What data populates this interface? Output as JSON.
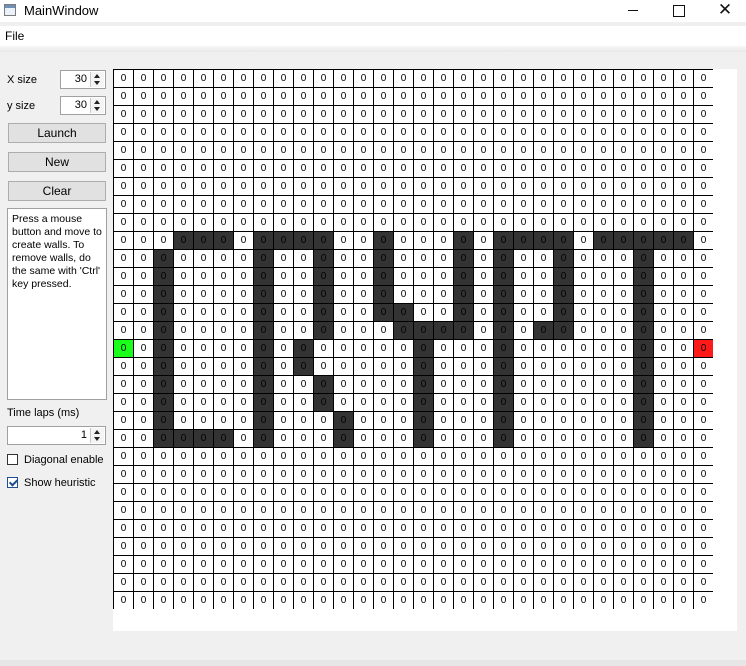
{
  "window": {
    "title": "MainWindow"
  },
  "menu": {
    "file": "File"
  },
  "controls": {
    "x_size_label": "X size",
    "x_size_value": "30",
    "y_size_label": "y size",
    "y_size_value": "30",
    "launch": "Launch",
    "new": "New",
    "clear": "Clear",
    "help_text": "Press a mouse button and move to create walls. To remove walls, do the same with 'Ctrl' key pressed.",
    "time_laps_label": "Time laps (ms)",
    "time_laps_value": "1",
    "diagonal_label": "Diagonal enable",
    "diagonal_checked": false,
    "heuristic_label": "Show heuristic",
    "heuristic_checked": true
  },
  "icons": {
    "app": "window-app-icon",
    "minimize": "minimize-icon",
    "maximize": "maximize-icon",
    "close": "close-icon",
    "start": "start-marker-icon",
    "goal": "goal-marker-icon"
  },
  "colors": {
    "wall": "#333333",
    "start": "#1aff1a",
    "goal": "#ff1a1a",
    "grid_line": "#000000",
    "cell": "#ffffff"
  },
  "grid": {
    "cols": 30,
    "rows": 30,
    "cell_value": "0",
    "start": [
      0,
      15
    ],
    "goal": [
      29,
      15
    ],
    "walls": [
      [
        3,
        9
      ],
      [
        4,
        9
      ],
      [
        5,
        9
      ],
      [
        7,
        9
      ],
      [
        8,
        9
      ],
      [
        9,
        9
      ],
      [
        10,
        9
      ],
      [
        13,
        9
      ],
      [
        17,
        9
      ],
      [
        19,
        9
      ],
      [
        20,
        9
      ],
      [
        21,
        9
      ],
      [
        22,
        9
      ],
      [
        24,
        9
      ],
      [
        25,
        9
      ],
      [
        26,
        9
      ],
      [
        27,
        9
      ],
      [
        28,
        9
      ],
      [
        2,
        10
      ],
      [
        7,
        10
      ],
      [
        10,
        10
      ],
      [
        13,
        10
      ],
      [
        17,
        10
      ],
      [
        19,
        10
      ],
      [
        22,
        10
      ],
      [
        26,
        10
      ],
      [
        2,
        11
      ],
      [
        7,
        11
      ],
      [
        10,
        11
      ],
      [
        13,
        11
      ],
      [
        17,
        11
      ],
      [
        19,
        11
      ],
      [
        22,
        11
      ],
      [
        26,
        11
      ],
      [
        2,
        12
      ],
      [
        7,
        12
      ],
      [
        10,
        12
      ],
      [
        13,
        12
      ],
      [
        17,
        12
      ],
      [
        19,
        12
      ],
      [
        22,
        12
      ],
      [
        26,
        12
      ],
      [
        2,
        13
      ],
      [
        7,
        13
      ],
      [
        10,
        13
      ],
      [
        13,
        13
      ],
      [
        14,
        13
      ],
      [
        17,
        13
      ],
      [
        19,
        13
      ],
      [
        22,
        13
      ],
      [
        26,
        13
      ],
      [
        2,
        14
      ],
      [
        7,
        14
      ],
      [
        10,
        14
      ],
      [
        14,
        14
      ],
      [
        15,
        14
      ],
      [
        16,
        14
      ],
      [
        17,
        14
      ],
      [
        19,
        14
      ],
      [
        21,
        14
      ],
      [
        22,
        14
      ],
      [
        26,
        14
      ],
      [
        2,
        15
      ],
      [
        7,
        15
      ],
      [
        9,
        15
      ],
      [
        15,
        15
      ],
      [
        19,
        15
      ],
      [
        26,
        15
      ],
      [
        2,
        16
      ],
      [
        7,
        16
      ],
      [
        9,
        16
      ],
      [
        15,
        16
      ],
      [
        19,
        16
      ],
      [
        26,
        16
      ],
      [
        2,
        17
      ],
      [
        7,
        17
      ],
      [
        10,
        17
      ],
      [
        15,
        17
      ],
      [
        19,
        17
      ],
      [
        26,
        17
      ],
      [
        2,
        18
      ],
      [
        7,
        18
      ],
      [
        10,
        18
      ],
      [
        15,
        18
      ],
      [
        19,
        18
      ],
      [
        26,
        18
      ],
      [
        2,
        19
      ],
      [
        7,
        19
      ],
      [
        11,
        19
      ],
      [
        15,
        19
      ],
      [
        19,
        19
      ],
      [
        26,
        19
      ],
      [
        2,
        20
      ],
      [
        3,
        20
      ],
      [
        4,
        20
      ],
      [
        5,
        20
      ],
      [
        7,
        20
      ],
      [
        11,
        20
      ],
      [
        15,
        20
      ],
      [
        19,
        20
      ],
      [
        26,
        20
      ]
    ]
  }
}
